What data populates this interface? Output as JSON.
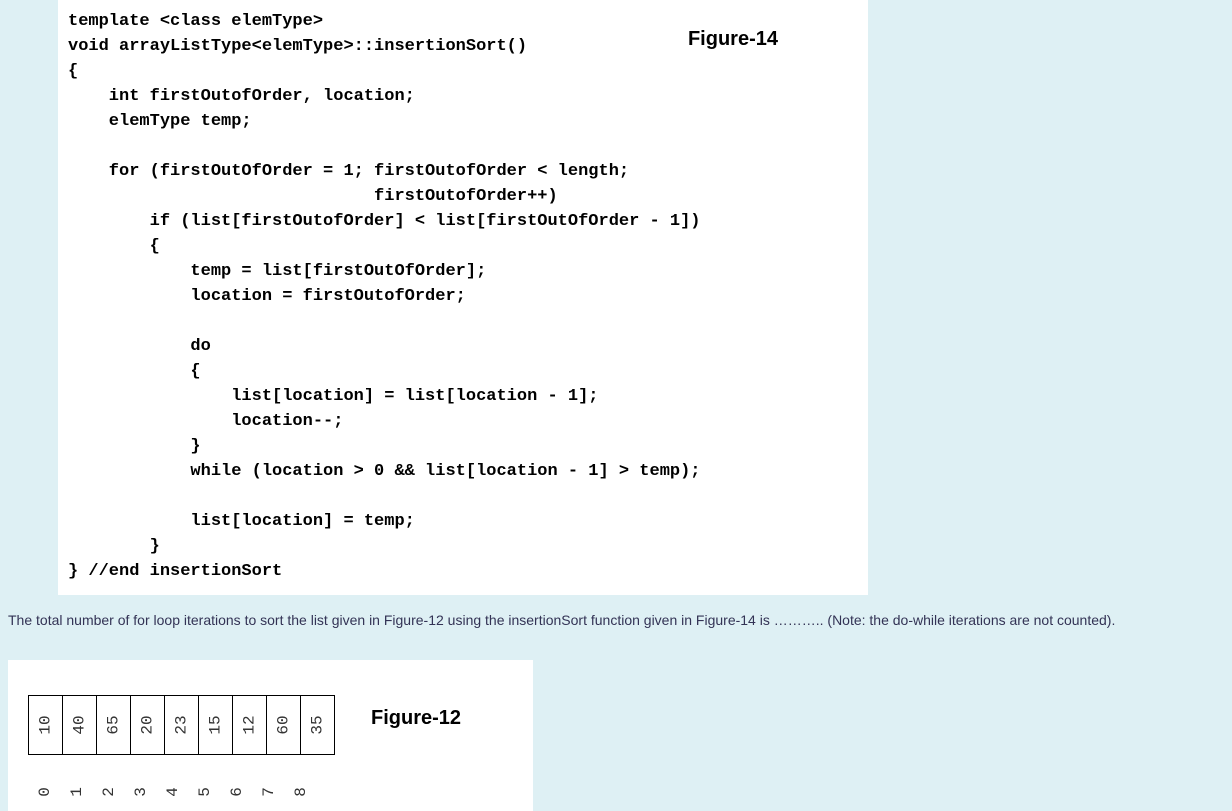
{
  "figure14": {
    "label": "Figure-14",
    "code_lines": [
      "template <class elemType>",
      "void arrayListType<elemType>::insertionSort()",
      "{",
      "    int firstOutofOrder, location;",
      "    elemType temp;",
      "",
      "    for (firstOutOfOrder = 1; firstOutofOrder < length;",
      "                              firstOutofOrder++)",
      "        if (list[firstOutofOrder] < list[firstOutOfOrder - 1])",
      "        {",
      "            temp = list[firstOutOfOrder];",
      "            location = firstOutofOrder;",
      "",
      "            do",
      "            {",
      "                list[location] = list[location - 1];",
      "                location--;",
      "            }",
      "            while (location > 0 && list[location - 1] > temp);",
      "",
      "            list[location] = temp;",
      "        }",
      "} //end insertionSort"
    ]
  },
  "question_text": "The total number of for loop iterations to sort the list given in Figure-12 using the insertionSort function given in Figure-14 is ……….. (Note: the do-while iterations are not counted).",
  "figure12": {
    "label": "Figure-12",
    "values": [
      "10",
      "40",
      "65",
      "20",
      "23",
      "15",
      "12",
      "60",
      "35"
    ],
    "indices": [
      "0",
      "1",
      "2",
      "3",
      "4",
      "5",
      "6",
      "7",
      "8"
    ]
  }
}
